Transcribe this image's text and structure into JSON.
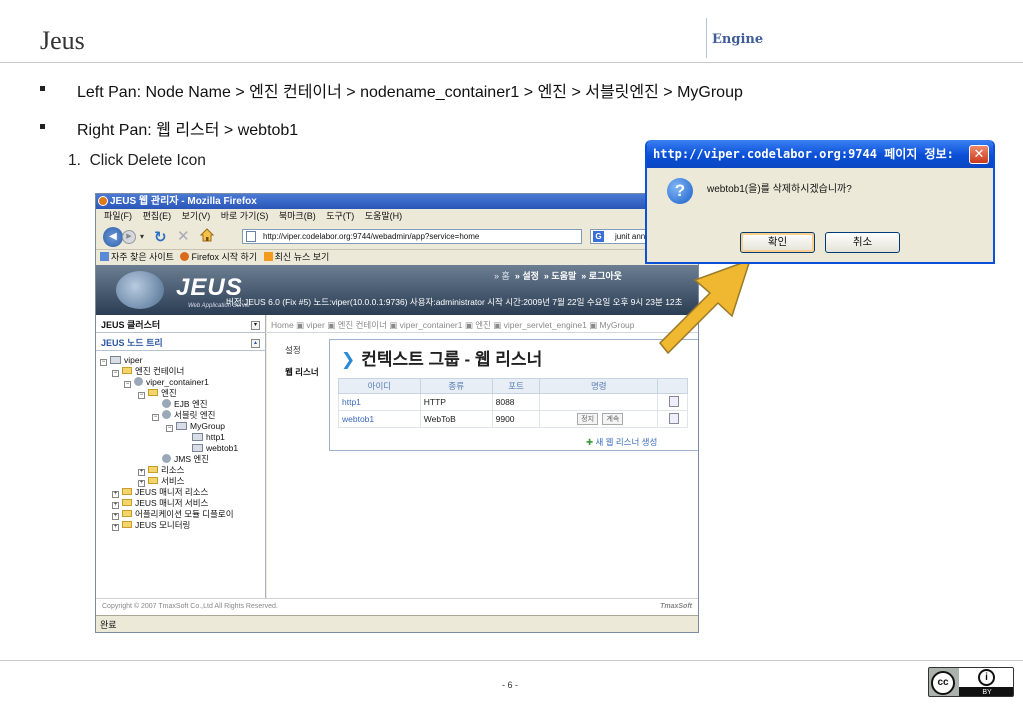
{
  "header": {
    "title": "Jeus",
    "section": "Engine"
  },
  "bullets": [
    "Left Pan: Node Name > 엔진 컨테이너 > nodename_container1 > 엔진 > 서블릿엔진 > MyGroup",
    "Right Pan: 웹 리스터 > webtob1"
  ],
  "step": {
    "number": "1.",
    "text": "Click Delete Icon"
  },
  "browser": {
    "title": "JEUS 웹 관리자 - Mozilla Firefox",
    "menu": [
      "파일(F)",
      "편집(E)",
      "보기(V)",
      "바로 가기(S)",
      "북마크(B)",
      "도구(T)",
      "도움말(H)"
    ],
    "url": "http://viper.codelabor.org:9744/webadmin/app?service=home",
    "search_text": "junit annota",
    "bookmarks": [
      "자주 찾은 사이트",
      "Firefox 시작 하기",
      "최신 뉴스 보기"
    ],
    "status": "완료",
    "copyright": "Copyright © 2007 TmaxSoft Co.,Ltd All Rights Reserved.",
    "tmax_logo": "TmaxSoft"
  },
  "app": {
    "logo": "JEUS",
    "logo_sub": "Web Application Server",
    "top_links": [
      "» 홈",
      "» 설정",
      "» 도움말",
      "» 로그아웃"
    ],
    "info": "버전:JEUS 6.0 (Fix #5)  노드:viper(10.0.0.1:9736)  사용자:administrator  시작 시간:2009년 7월 22일 수요일 오후 9시 23분 12초",
    "sidebar": {
      "header1": "JEUS 클러스터",
      "header2": "JEUS 노드 트리",
      "tree": [
        "viper",
        "엔진 컨테이너",
        "viper_container1",
        "엔진",
        "EJB 엔진",
        "서블릿 엔진",
        "MyGroup",
        "http1",
        "webtob1",
        "JMS 엔진",
        "리소스",
        "서비스",
        "JEUS 매니저 리소스",
        "JEUS 매니저 서비스",
        "어플리케이션 모듈 디플로이",
        "JEUS 모니터링"
      ]
    },
    "breadcrumb": "Home  ▣ viper  ▣ 엔진 컨테이너  ▣ viper_container1  ▣ 엔진  ▣ viper_servlet_engine1  ▣ MyGroup",
    "subtabs": [
      "설정",
      "웹 리스너"
    ],
    "content_title": "컨텍스트 그룹 - 웹 리스너",
    "table": {
      "columns": [
        "아이디",
        "종류",
        "포트",
        "명령"
      ],
      "rows": [
        {
          "id": "http1",
          "type": "HTTP",
          "port": "8088",
          "cmd": []
        },
        {
          "id": "webtob1",
          "type": "WebToB",
          "port": "9900",
          "cmd": [
            "정지",
            "계속"
          ]
        }
      ]
    },
    "new_listener": "새 웹 리스너 생성"
  },
  "dialog": {
    "title": "http://viper.codelabor.org:9744 페이지 정보:",
    "message": "webtob1(을)를 삭제하시겠습니까?",
    "ok": "확인",
    "cancel": "취소"
  },
  "footer": {
    "page": "- 6 -",
    "license": "BY"
  },
  "colors": {
    "accent": "#3f5d96",
    "arrow": "#f0b830",
    "dialog_title": "#0a50d8"
  }
}
